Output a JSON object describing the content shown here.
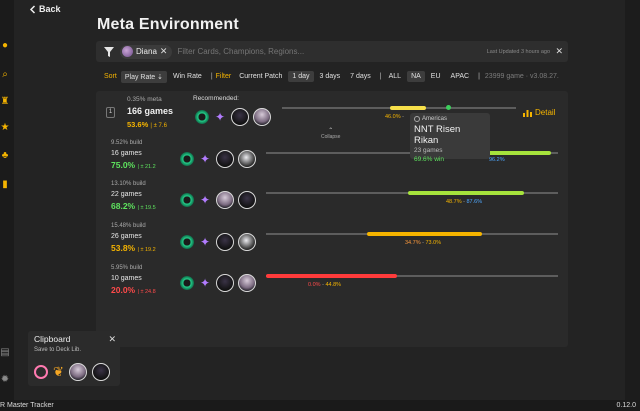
{
  "nav": {
    "back_label": "Back"
  },
  "page": {
    "title": "Meta Environment"
  },
  "filter": {
    "chip_label": "Diana",
    "placeholder": "Filter Cards, Champions, Regions...",
    "last_updated": "Last Updated 3 hours ago"
  },
  "sort": {
    "sort_label": "Sort",
    "play_rate": "Play Rate",
    "win_rate": "Win Rate",
    "filter_label": "Filter",
    "current_patch": "Current Patch",
    "periods": [
      "1 day",
      "3 days",
      "7 days"
    ],
    "regions": [
      "ALL",
      "NA",
      "EU",
      "APAC"
    ],
    "meta_info": "23999 game · v3.08.27."
  },
  "top": {
    "index": "1",
    "meta_pct": "0.35% meta",
    "games": "166 games",
    "win_rate": "53.6%",
    "delta": "| ± 7.6",
    "recommended": "Recommended:",
    "bar_wr": "46.0%",
    "bar_dash": " - ",
    "collapse": "Collapse",
    "detail": "Detail"
  },
  "builds": [
    {
      "build_pct": "9.52% build",
      "games": "16 games",
      "wr": "75.0%",
      "delta": "| ± 21.2",
      "label_a": "",
      "label_b": "96.2%",
      "wr_color": "#5ee35e"
    },
    {
      "build_pct": "13.10% build",
      "games": "22 games",
      "wr": "68.2%",
      "delta": "| ± 19.5",
      "label_a": "48.7%",
      "label_b": "87.6%",
      "wr_color": "#5ee35e"
    },
    {
      "build_pct": "15.48% build",
      "games": "26 games",
      "wr": "53.8%",
      "delta": "| ± 19.2",
      "label_a": "34.7%",
      "label_b": "73.0%",
      "wr_color": "#f5b400"
    },
    {
      "build_pct": "5.95% build",
      "games": "10 games",
      "wr": "20.0%",
      "delta": "| ± 24.8",
      "label_a": "0.0%",
      "label_b": "44.8%",
      "wr_color": "#ff4a4a"
    }
  ],
  "tooltip": {
    "region": "Americas",
    "name": "NNT Risen Rikan",
    "games": "23 games",
    "win": "69.6% win"
  },
  "clipboard": {
    "title": "Clipboard",
    "subtitle": "Save to Deck Lib."
  },
  "footer": {
    "app_name": "R Master Tracker",
    "version": "0.12.0"
  },
  "colors": {
    "accent": "#f5b400",
    "green": "#5ee35e",
    "blue": "#4fa8ff",
    "red": "#ff4a4a"
  }
}
